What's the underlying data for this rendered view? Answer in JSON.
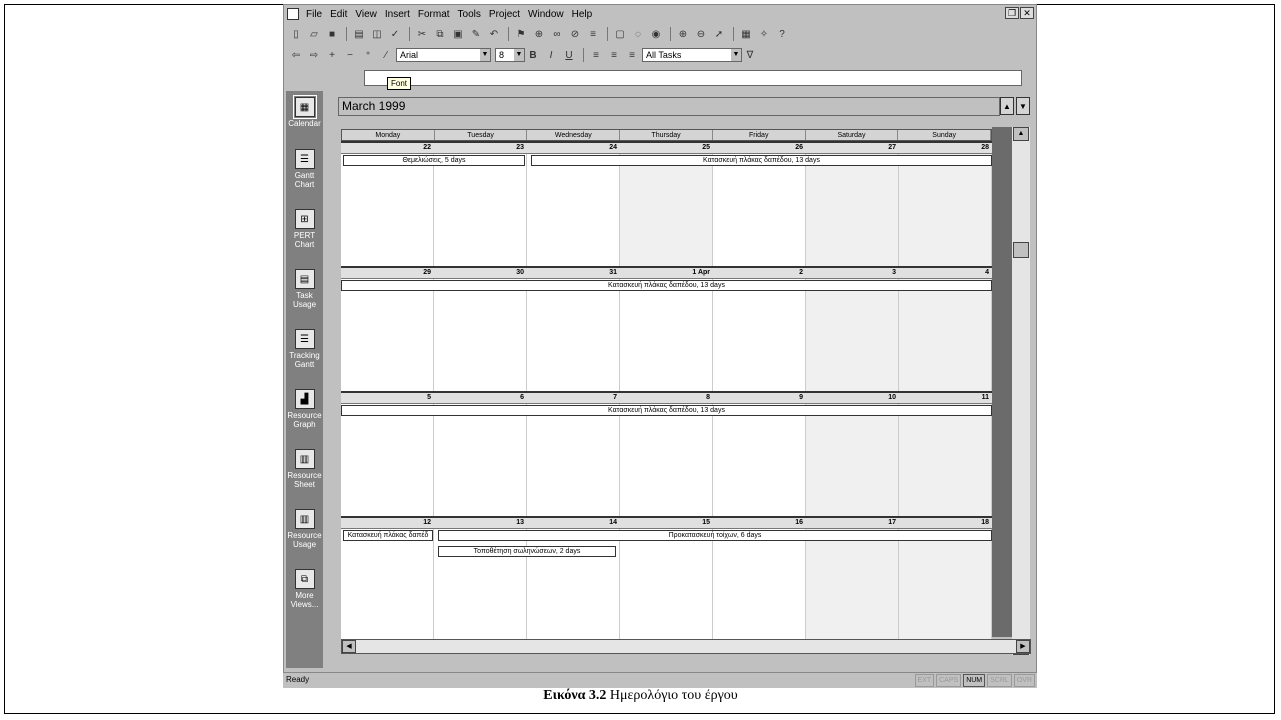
{
  "menu": [
    "File",
    "Edit",
    "View",
    "Insert",
    "Format",
    "Tools",
    "Project",
    "Window",
    "Help"
  ],
  "toolbar": {
    "font_name": "Arial",
    "font_size": "8",
    "filter": "All Tasks",
    "tooltip": "Font"
  },
  "calendar": {
    "month_title": "March 1999",
    "day_names": [
      "Monday",
      "Tuesday",
      "Wednesday",
      "Thursday",
      "Friday",
      "Saturday",
      "Sunday"
    ],
    "weeks": [
      {
        "days": [
          "22",
          "23",
          "24",
          "25",
          "26",
          "27",
          "28"
        ]
      },
      {
        "days": [
          "29",
          "30",
          "31",
          "1 Apr",
          "2",
          "3",
          "4"
        ]
      },
      {
        "days": [
          "5",
          "6",
          "7",
          "8",
          "9",
          "10",
          "11"
        ]
      },
      {
        "days": [
          "12",
          "13",
          "14",
          "15",
          "16",
          "17",
          "18"
        ]
      }
    ],
    "tasks": {
      "w1_a": "Θεμελιώσεις, 5 days",
      "w1_b": "Κατασκευή πλάκας δαπέδου, 13 days",
      "w2_a": "Κατασκευή πλάκας δαπέδου, 13 days",
      "w3_a": "Κατασκευή πλάκας δαπέδου, 13 days",
      "w4_a": "Κατασκευή πλάκας δαπέδ",
      "w4_b": "Προκατασκευή τοίχων, 6 days",
      "w4_c": "Τοποθέτηση σωληνώσεων, 2 days"
    }
  },
  "view_bar": [
    {
      "label": "Calendar",
      "icon": "calendar-icon"
    },
    {
      "label": "Gantt Chart",
      "icon": "gantt-chart-icon"
    },
    {
      "label": "PERT Chart",
      "icon": "pert-chart-icon"
    },
    {
      "label": "Task Usage",
      "icon": "task-usage-icon"
    },
    {
      "label": "Tracking Gantt",
      "icon": "tracking-gantt-icon"
    },
    {
      "label": "Resource Graph",
      "icon": "resource-graph-icon"
    },
    {
      "label": "Resource Sheet",
      "icon": "resource-sheet-icon"
    },
    {
      "label": "Resource Usage",
      "icon": "resource-usage-icon"
    },
    {
      "label": "More Views...",
      "icon": "more-views-icon"
    }
  ],
  "status": {
    "text": "Ready",
    "indicators": [
      "EXT",
      "CAPS",
      "NUM",
      "SCRL",
      "OVR"
    ]
  },
  "caption": {
    "label": "Εικόνα 3.2",
    "text": " Ημερολόγιο του έργου"
  }
}
